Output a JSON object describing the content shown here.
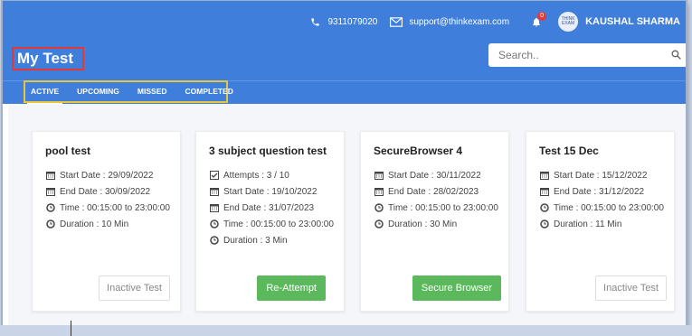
{
  "topbar": {
    "phone": "9311079020",
    "email": "support@thinkexam.com",
    "notifications_count": "0",
    "username": "KAUSHAL SHARMA",
    "avatar_text": "THINK EXAM"
  },
  "page": {
    "title": "My Test"
  },
  "search": {
    "placeholder": "Search.."
  },
  "tabs": [
    {
      "label": "ACTIVE"
    },
    {
      "label": "UPCOMING"
    },
    {
      "label": "MISSED"
    },
    {
      "label": "COMPLETED"
    }
  ],
  "cards": [
    {
      "title": "pool test",
      "start": "Start Date : 29/09/2022",
      "end": "End Date : 30/09/2022",
      "time": "Time : 00:15:00 to 23:00:00",
      "duration": "Duration : 10 Min",
      "button": "Inactive Test"
    },
    {
      "title": "3 subject question test",
      "attempts": "Attempts : 3 / 10",
      "start": "Start Date : 19/10/2022",
      "end": "End Date : 31/07/2023",
      "time": "Time : 00:15:00 to 23:00:00",
      "duration": "Duration : 3 Min",
      "button": "Re-Attempt"
    },
    {
      "title": "SecureBrowser 4",
      "start": "Start Date : 30/11/2022",
      "end": "End Date : 28/02/2023",
      "time": "Time : 00:15:00 to 23:00:00",
      "duration": "Duration : 30 Min",
      "button": "Secure Browser"
    },
    {
      "title": "Test 15 Dec",
      "start": "Start Date : 15/12/2022",
      "end": "End Date : 31/12/2022",
      "time": "Time : 00:15:00 to 23:00:00",
      "duration": "Duration : 11 Min",
      "button": "Inactive Test"
    }
  ],
  "colors": {
    "header": "#3f7fdb",
    "green": "#5cb85c",
    "highlight_red": "#e53935",
    "highlight_yellow": "#e8c53a"
  }
}
